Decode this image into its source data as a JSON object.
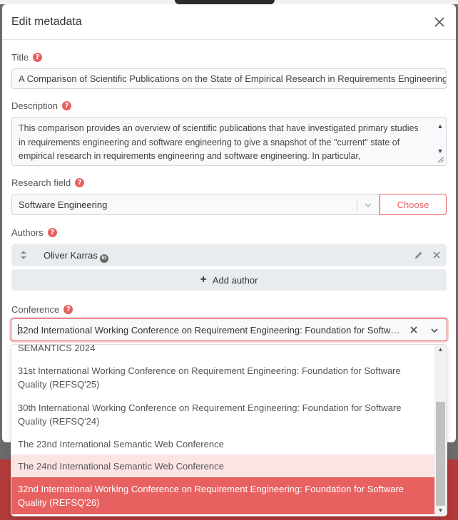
{
  "modal": {
    "title": "Edit metadata"
  },
  "fields": {
    "title_label": "Title",
    "title_value": "A Comparison of Scientific Publications on the State of Empirical Research in Requirements Engineering",
    "description_label": "Description",
    "description_value": "This comparison provides an overview of scientific publications that have investigated primary studies in requirements engineering and software engineering to give a snapshot of the \"current\" state of empirical research in requirements engineering and software engineering. In particular,",
    "research_field_label": "Research field",
    "research_field_value": "Software Engineering",
    "choose_label": "Choose",
    "authors_label": "Authors",
    "authors": [
      {
        "name": "Oliver Karras"
      }
    ],
    "add_author_label": "Add author",
    "conference_label": "Conference",
    "conference_value": "32nd International Working Conference on Requirement Engineering: Foundation for Software Quality (REFSQ'26)"
  },
  "help_icon_glyph": "?",
  "orcid_glyph": "iD",
  "conference_options": [
    {
      "label": "SEMANTICS 2024",
      "state": "normal"
    },
    {
      "label": "31st International Working Conference on Requirement Engineering: Foundation for Software Quality (REFSQ'25)",
      "state": "normal"
    },
    {
      "label": "30th International Working Conference on Requirement Engineering: Foundation for Software Quality (REFSQ'24)",
      "state": "normal"
    },
    {
      "label": "The 23nd International Semantic Web Conference",
      "state": "normal"
    },
    {
      "label": "The 24nd International Semantic Web Conference",
      "state": "hover"
    },
    {
      "label": "32nd International Working Conference on Requirement Engineering: Foundation for Software Quality (REFSQ'26)",
      "state": "selected"
    }
  ],
  "colors": {
    "accent": "#e86161",
    "hover": "#fbe4e4",
    "field_bg": "#f8f9fa"
  },
  "icons": {
    "close": "close-icon",
    "help": "help-icon",
    "chevron": "chevron-down-icon",
    "drag": "drag-handle-icon",
    "edit": "pencil-icon",
    "remove": "remove-icon",
    "plus": "plus-icon",
    "orcid": "orcid-icon"
  }
}
